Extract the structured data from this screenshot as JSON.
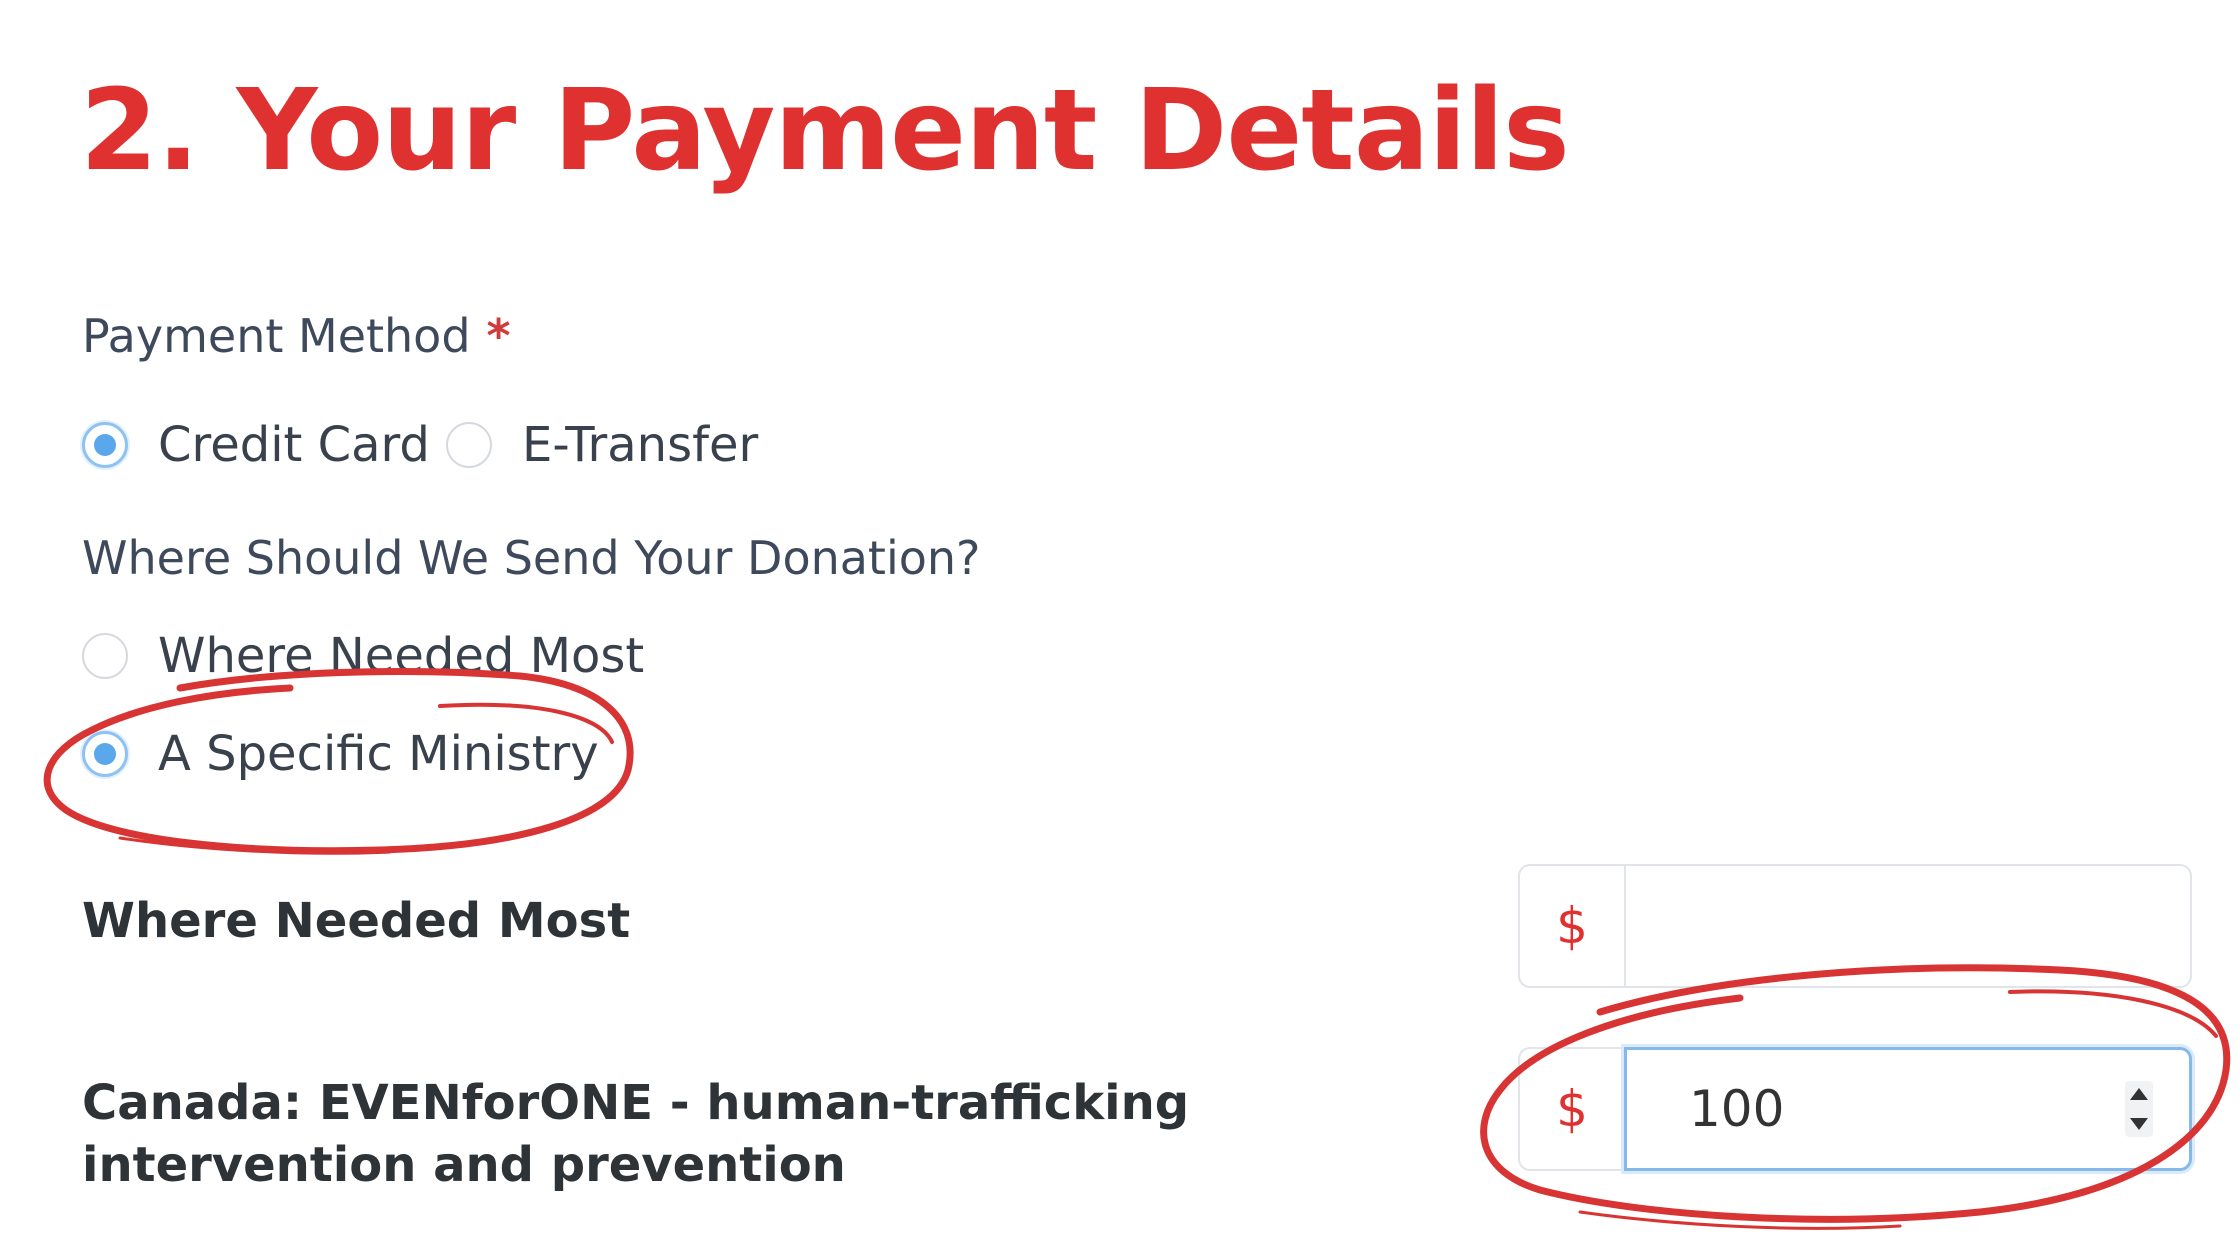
{
  "section": {
    "title": "2. Your Payment Details"
  },
  "payment_method": {
    "label": "Payment Method",
    "required_mark": "*",
    "options": [
      {
        "label": "Credit Card",
        "checked": true
      },
      {
        "label": "E-Transfer",
        "checked": false
      }
    ]
  },
  "destination": {
    "question": "Where Should We Send Your Donation?",
    "options": [
      {
        "label": "Where Needed Most",
        "checked": false
      },
      {
        "label": "A Specific Ministry",
        "checked": true
      }
    ]
  },
  "allocations": [
    {
      "label": "Where Needed Most",
      "currency": "$",
      "value": ""
    },
    {
      "label": "Canada: EVENforONE - human-trafficking intervention and prevention",
      "currency": "$",
      "value": "100"
    }
  ],
  "colors": {
    "title": "#e03131",
    "radio_selected": "#5aa7ec",
    "annotation": "#d83434",
    "currency_symbol": "#e03131"
  },
  "icons": {
    "spinner_up": "triangle-up",
    "spinner_down": "triangle-down"
  }
}
